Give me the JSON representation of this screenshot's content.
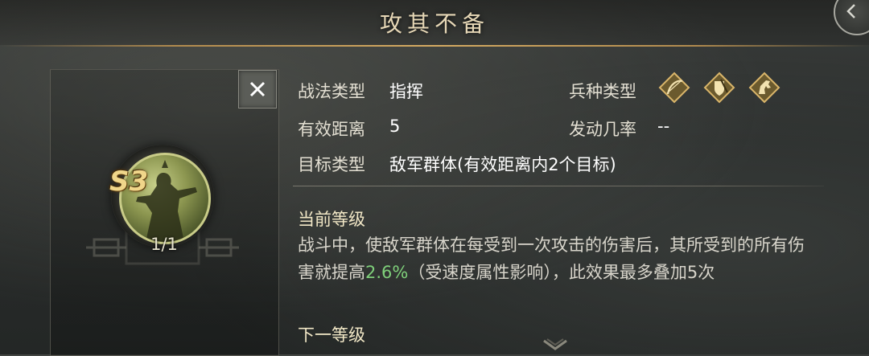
{
  "header": {
    "title": "攻其不备"
  },
  "skill": {
    "grade": "S3",
    "level_count": "1/1"
  },
  "info": {
    "tactic_type_label": "战法类型",
    "tactic_type_value": "指挥",
    "range_label": "有效距离",
    "range_value": "5",
    "target_label": "目标类型",
    "target_value": "敌军群体(有效距离内2个目标)",
    "troop_label": "兵种类型",
    "troop_icons": [
      "bow-troop-icon",
      "shield-troop-icon",
      "cavalry-troop-icon"
    ],
    "trigger_label": "发动几率",
    "trigger_value": "--"
  },
  "current_level": {
    "title": "当前等级",
    "desc_part1": "战斗中，使敌军群体在每受到一次攻击的伤害后，其所受到的所有伤害就提高",
    "desc_highlight": "2.6%",
    "desc_part2": "（受速度属性影响），此效果最多叠加5次"
  },
  "next_level": {
    "title": "下一等级"
  },
  "colors": {
    "accent_gold": "#d4aa62",
    "highlight_green": "#7fd07a"
  }
}
